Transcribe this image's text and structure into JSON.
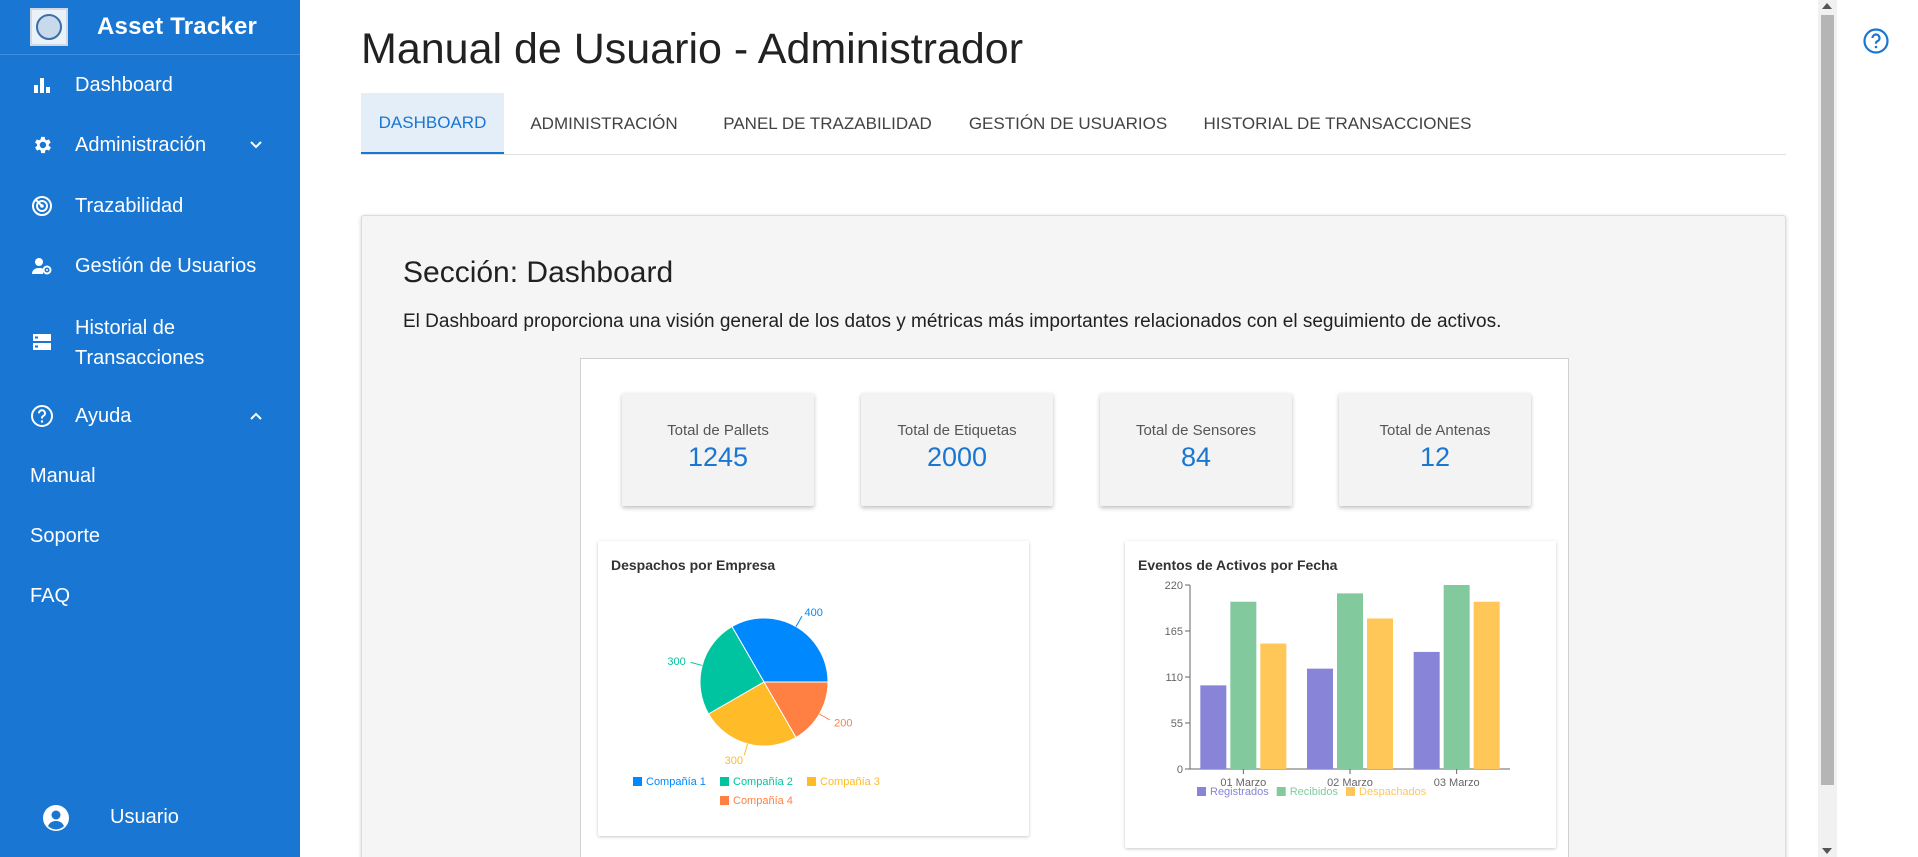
{
  "sidebar": {
    "title": "Asset Tracker",
    "items": [
      {
        "label": "Dashboard",
        "icon": "bar-chart-icon"
      },
      {
        "label": "Administración",
        "icon": "gear-icon"
      },
      {
        "label": "Trazabilidad",
        "icon": "radar-icon"
      },
      {
        "label": "Gestión de Usuarios",
        "icon": "user-gear-icon"
      },
      {
        "label_line1": "Historial de",
        "label_line2": "Transacciones",
        "icon": "storage-icon"
      },
      {
        "label": "Ayuda",
        "icon": "help-circle-icon"
      }
    ],
    "help_subitems": [
      "Manual",
      "Soporte",
      "FAQ"
    ],
    "user": "Usuario"
  },
  "page": {
    "title": "Manual de Usuario - Administrador",
    "tabs": [
      "DASHBOARD",
      "ADMINISTRACIÓN",
      "PANEL DE TRAZABILIDAD",
      "GESTIÓN DE USUARIOS",
      "HISTORIAL DE TRANSACCIONES"
    ],
    "active_tab": "DASHBOARD"
  },
  "section": {
    "title": "Sección: Dashboard",
    "description": "El Dashboard proporciona una visión general de los datos y métricas más importantes relacionados con el seguimiento de activos."
  },
  "stats": [
    {
      "label": "Total de Pallets",
      "value": "1245"
    },
    {
      "label": "Total de Etiquetas",
      "value": "2000"
    },
    {
      "label": "Total de Sensores",
      "value": "84"
    },
    {
      "label": "Total de Antenas",
      "value": "12"
    }
  ],
  "colors": {
    "accent": "#1976d2",
    "sidebar": "#1976d2"
  },
  "chart_data": [
    {
      "type": "pie",
      "title": "Despachos por Empresa",
      "categories": [
        "Compañía 1",
        "Compañía 2",
        "Compañía 3",
        "Compañía 4"
      ],
      "values": [
        400,
        300,
        300,
        200
      ],
      "colors": [
        "#0088fe",
        "#00c49f",
        "#ffbb28",
        "#ff8042"
      ],
      "legend": "bottom"
    },
    {
      "type": "bar",
      "title": "Eventos de Activos por Fecha",
      "categories": [
        "01 Marzo",
        "02 Marzo",
        "03 Marzo"
      ],
      "series": [
        {
          "name": "Registrados",
          "values": [
            100,
            120,
            140
          ],
          "color": "#8884d8"
        },
        {
          "name": "Recibidos",
          "values": [
            200,
            210,
            220
          ],
          "color": "#82ca9d"
        },
        {
          "name": "Despachados",
          "values": [
            150,
            180,
            200
          ],
          "color": "#ffc658"
        }
      ],
      "yticks": [
        0,
        55,
        110,
        165,
        220
      ],
      "ylim": [
        0,
        220
      ],
      "legend": "bottom"
    }
  ]
}
